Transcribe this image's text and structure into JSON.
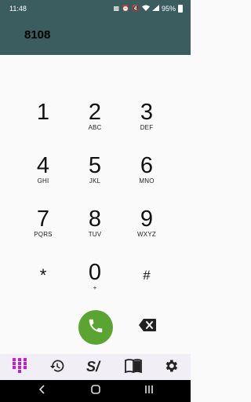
{
  "status_bar": {
    "time": "11:48",
    "battery": "95%"
  },
  "dialer": {
    "number": "8108"
  },
  "keys": [
    {
      "digit": "1",
      "letters": ""
    },
    {
      "digit": "2",
      "letters": "ABC"
    },
    {
      "digit": "3",
      "letters": "DEF"
    },
    {
      "digit": "4",
      "letters": "GHI"
    },
    {
      "digit": "5",
      "letters": "JKL"
    },
    {
      "digit": "6",
      "letters": "MNO"
    },
    {
      "digit": "7",
      "letters": "PQRS"
    },
    {
      "digit": "8",
      "letters": "TUV"
    },
    {
      "digit": "9",
      "letters": "WXYZ"
    },
    {
      "digit": "*",
      "letters": ""
    },
    {
      "digit": "0",
      "letters": "+"
    },
    {
      "digit": "#",
      "letters": ""
    }
  ],
  "actions": {
    "call_icon": "phone-icon",
    "backspace_icon": "backspace-icon"
  },
  "bottom_nav": [
    {
      "icon": "dialpad-icon",
      "active": true
    },
    {
      "icon": "history-icon",
      "active": false
    },
    {
      "icon": "speed-dial-icon",
      "active": false
    },
    {
      "icon": "contacts-book-icon",
      "active": false
    },
    {
      "icon": "settings-gear-icon",
      "active": false
    }
  ],
  "colors": {
    "header": "#3b5d5f",
    "call_button": "#5aa432",
    "active_tab": "#c61bd0",
    "nav_background": "#f2eef5"
  }
}
